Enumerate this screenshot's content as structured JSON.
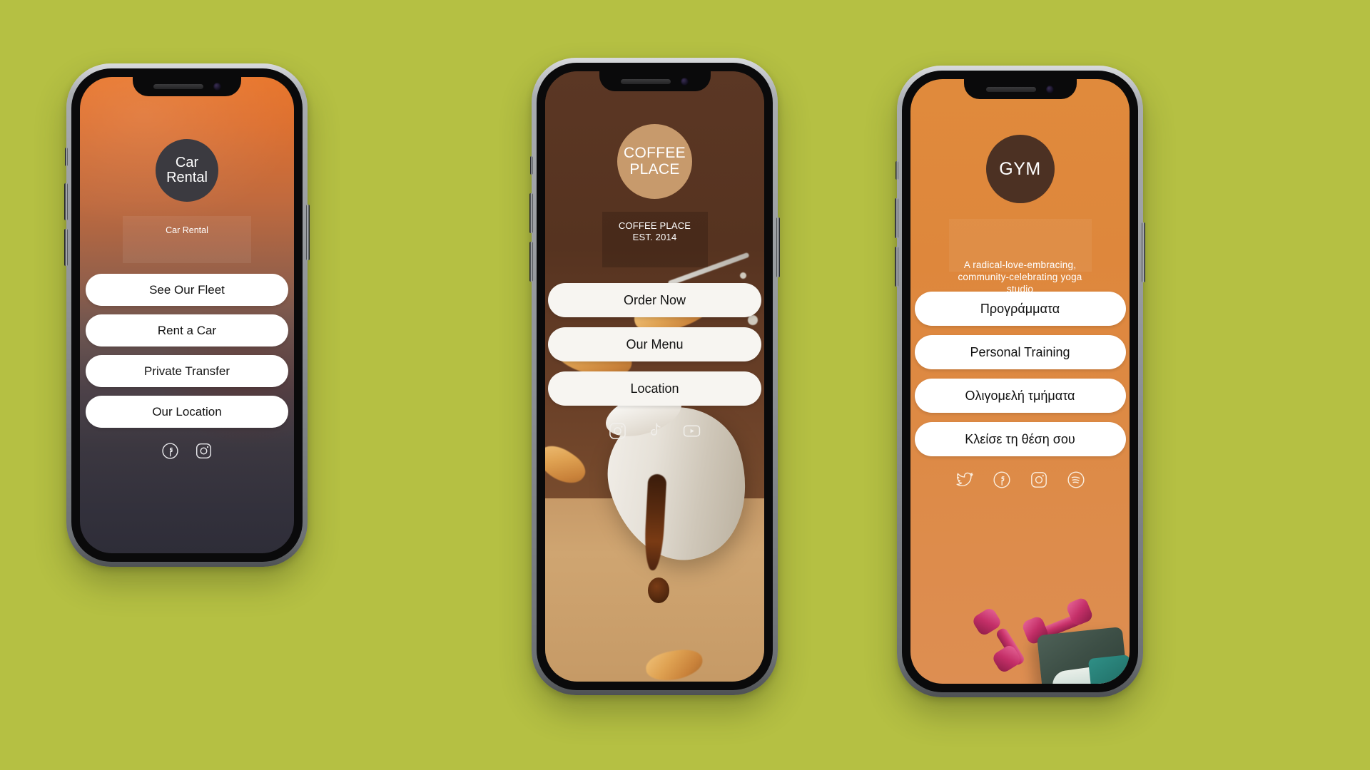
{
  "page": {
    "background_color": "#b5c043",
    "title": "Mobile link-in-bio landing page mockups"
  },
  "phones": [
    {
      "id": "car-rental",
      "logo_text_line1": "Car",
      "logo_text_line2": "Rental",
      "logo_circle_color": "#3b3a40",
      "tagline": "Car Rental",
      "screen_gradient_from": "#e8762c",
      "screen_gradient_to": "#2e2d38",
      "buttons": [
        {
          "label": "See Our Fleet"
        },
        {
          "label": "Rent a Car"
        },
        {
          "label": "Private Transfer"
        },
        {
          "label": "Our Location"
        }
      ],
      "socials": [
        {
          "icon": "facebook-icon",
          "label": "Facebook"
        },
        {
          "icon": "instagram-icon",
          "label": "Instagram"
        }
      ]
    },
    {
      "id": "coffee-place",
      "logo_text_line1": "COFFEE",
      "logo_text_line2": "PLACE",
      "logo_circle_color": "#c79a6c",
      "tagline_line1": "COFFEE PLACE",
      "tagline_line2": "EST. 2014",
      "screen_background_color": "#4a2d1e",
      "buttons": [
        {
          "label": "Order Now"
        },
        {
          "label": "Our Menu"
        },
        {
          "label": "Location"
        }
      ],
      "socials": [
        {
          "icon": "instagram-icon",
          "label": "Instagram"
        },
        {
          "icon": "tiktok-icon",
          "label": "TikTok"
        },
        {
          "icon": "youtube-icon",
          "label": "YouTube"
        }
      ]
    },
    {
      "id": "gym",
      "logo_text": "GYM",
      "logo_circle_color": "#4c3123",
      "tagline_line1": "A radical-love-embracing,",
      "tagline_line2": "community-celebrating yoga studio",
      "screen_gradient_from": "#e08a3c",
      "screen_gradient_to": "#dd8e52",
      "buttons": [
        {
          "label": "Προγράμματα"
        },
        {
          "label": "Personal Training"
        },
        {
          "label": "Ολιγομελή τμήματα"
        },
        {
          "label": "Κλείσε τη θέση σου"
        }
      ],
      "socials": [
        {
          "icon": "twitter-icon",
          "label": "Twitter"
        },
        {
          "icon": "facebook-icon",
          "label": "Facebook"
        },
        {
          "icon": "instagram-icon",
          "label": "Instagram"
        },
        {
          "icon": "spotify-icon",
          "label": "Spotify"
        }
      ]
    }
  ]
}
